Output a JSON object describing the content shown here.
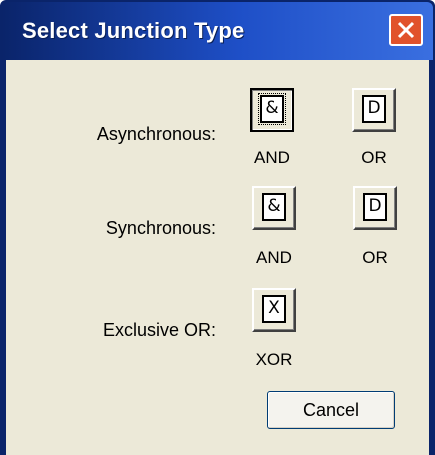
{
  "window": {
    "title": "Select Junction Type",
    "close_label": "✕"
  },
  "rows": [
    {
      "label": "Asynchronous:",
      "buttons": [
        {
          "glyph": "&",
          "caption": "AND",
          "selected": true
        },
        {
          "glyph": "D",
          "caption": "OR",
          "selected": false
        }
      ]
    },
    {
      "label": "Synchronous:",
      "buttons": [
        {
          "glyph": "&",
          "caption": "AND",
          "selected": false
        },
        {
          "glyph": "D",
          "caption": "OR",
          "selected": false
        }
      ]
    },
    {
      "label": "Exclusive OR:",
      "buttons": [
        {
          "glyph": "X",
          "caption": "XOR",
          "selected": false
        }
      ]
    }
  ],
  "actions": {
    "cancel_label": "Cancel"
  },
  "colors": {
    "titlebar": "#0a246a",
    "dialog_face": "#ece9d8",
    "close_button": "#e1522b"
  }
}
